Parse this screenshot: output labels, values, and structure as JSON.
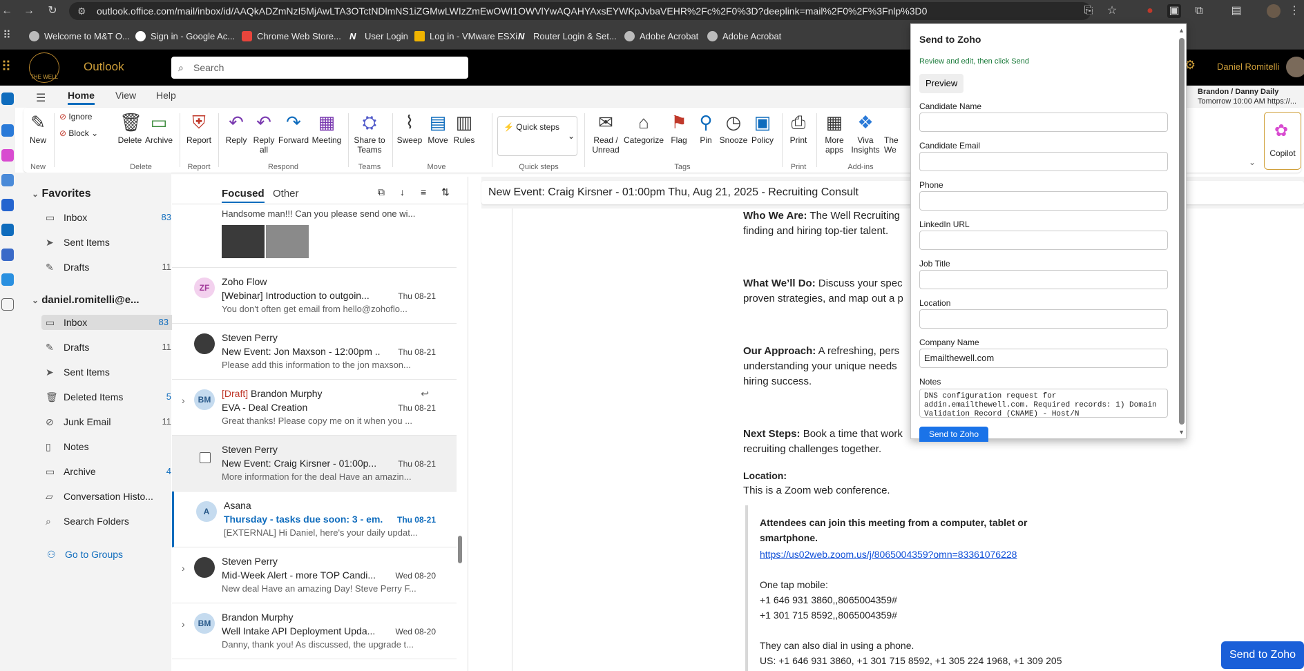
{
  "browser": {
    "url": "outlook.office.com/mail/inbox/id/AAQkADZmNzI5MjAwLTA3OTctNDlmNS1iZGMwLWIzZmEwOWI1OWVlYwAQAHYAxsEYWKpJvbaVEHR%2Fc%2F0%3D?deeplink=mail%2F0%2F%3Fnlp%3D0",
    "bookmarks": [
      "Welcome to M&T O...",
      "Sign in - Google Ac...",
      "Chrome Web Store...",
      "User Login",
      "Log in - VMware ESXi",
      "Router Login & Set...",
      "Adobe Acrobat",
      "Adobe Acrobat"
    ]
  },
  "header": {
    "app_name": "Outlook",
    "logo_text": "THE WELL",
    "search_placeholder": "Search",
    "user_name": "Daniel Romitelli",
    "next_event_title": "Brandon / Danny Daily",
    "next_event_time": "Tomorrow 10:00 AM https://..."
  },
  "ribbon": {
    "tabs": [
      "Home",
      "View",
      "Help"
    ],
    "buttons": {
      "new": "New",
      "ignore": "Ignore",
      "block": "Block",
      "delete": "Delete",
      "archive": "Archive",
      "report": "Report",
      "reply": "Reply",
      "reply_all": "Reply all",
      "forward": "Forward",
      "meeting": "Meeting",
      "share_teams": "Share to Teams",
      "sweep": "Sweep",
      "move": "Move",
      "rules": "Rules",
      "quick_steps": "Quick steps",
      "read_unread": "Read / Unread",
      "categorize": "Categorize",
      "flag": "Flag",
      "pin": "Pin",
      "snooze": "Snooze",
      "policy": "Policy",
      "print": "Print",
      "more_apps": "More apps",
      "viva": "Viva Insights",
      "the_well": "The We",
      "copilot": "Copilot"
    },
    "groups": {
      "new": "New",
      "delete": "Delete",
      "report": "Report",
      "respond": "Respond",
      "teams": "Teams",
      "move": "Move",
      "quick_steps": "Quick steps",
      "tags": "Tags",
      "print": "Print",
      "addins": "Add-ins"
    }
  },
  "folders": {
    "favorites_label": "Favorites",
    "favorites": [
      {
        "label": "Inbox",
        "count": "83"
      },
      {
        "label": "Sent Items",
        "count": ""
      },
      {
        "label": "Drafts",
        "count": "11"
      }
    ],
    "account_label": "daniel.romitelli@e...",
    "account": [
      {
        "label": "Inbox",
        "count": "83"
      },
      {
        "label": "Drafts",
        "count": "11"
      },
      {
        "label": "Sent Items",
        "count": ""
      },
      {
        "label": "Deleted Items",
        "count": "5"
      },
      {
        "label": "Junk Email",
        "count": "11"
      },
      {
        "label": "Notes",
        "count": ""
      },
      {
        "label": "Archive",
        "count": "4"
      },
      {
        "label": "Conversation Histo...",
        "count": ""
      },
      {
        "label": "Search Folders",
        "count": ""
      }
    ],
    "groups_link": "Go to Groups"
  },
  "messages": {
    "focused_tab": "Focused",
    "other_tab": "Other",
    "top_preview": "Handsome man!!! Can you please send one wi...",
    "items": [
      {
        "initials": "ZF",
        "from": "Zoho Flow",
        "draft": "",
        "subject": "[Webinar] Introduction to outgoin...",
        "date": "Thu 08-21",
        "preview": "You don't often get email from hello@zohoflo..."
      },
      {
        "initials": "",
        "from": "Steven Perry",
        "draft": "",
        "subject": "New Event: Jon Maxson - 12:00pm ...",
        "date": "Thu 08-21",
        "preview": "Please add this information to the jon maxson..."
      },
      {
        "initials": "BM",
        "from": "Brandon Murphy",
        "draft": "[Draft]",
        "subject": "EVA - Deal Creation",
        "date": "Thu 08-21",
        "preview": "Great thanks! Please copy me on it when you ..."
      },
      {
        "initials": "",
        "from": "Steven Perry",
        "draft": "",
        "subject": "New Event: Craig Kirsner - 01:00p...",
        "date": "Thu 08-21",
        "preview": "More information for the deal Have an amazin..."
      },
      {
        "initials": "A",
        "from": "Asana",
        "draft": "",
        "subject": "Thursday - tasks due soon: 3 - em...",
        "date": "Thu 08-21",
        "preview": "[EXTERNAL] Hi Daniel, here's your daily updat..."
      },
      {
        "initials": "",
        "from": "Steven Perry",
        "draft": "",
        "subject": "Mid-Week Alert - more TOP Candi...",
        "date": "Wed 08-20",
        "preview": "New deal Have an amazing Day! Steve Perry F..."
      },
      {
        "initials": "BM",
        "from": "Brandon Murphy",
        "draft": "",
        "subject": "Well Intake API Deployment Upda...",
        "date": "Wed 08-20",
        "preview": "Danny, thank you! As discussed, the upgrade t..."
      }
    ]
  },
  "reading": {
    "title": "New Event: Craig Kirsner - 01:00pm Thu, Aug 21, 2025 - Recruiting Consult",
    "who_label": "Who We Are:",
    "who_text": "The Well Recruiting",
    "who_text2": "finding and hiring top-tier talent.",
    "what_label": "What We’ll Do:",
    "what_text": "Discuss your spec",
    "what_text2": "proven strategies, and map out a p",
    "approach_label": "Our Approach:",
    "approach_text": "A refreshing, pers",
    "approach_text2": "understanding your unique needs",
    "approach_text3": "hiring success.",
    "next_label": "Next Steps:",
    "next_text": "Book a time that work",
    "next_text2": "recruiting challenges together.",
    "location_label": "Location:",
    "location_text": "This is a Zoom web conference.",
    "attendees": "Attendees can join this meeting from a computer, tablet or smartphone.",
    "zoom_link": "https://us02web.zoom.us/j/8065004359?omn=83361076228",
    "one_tap": "One tap mobile:",
    "phone1": "+1 646 931 3860,,8065004359#",
    "phone2": "+1 301 715 8592,,8065004359#",
    "dial": "They can also dial in using a phone.",
    "us": "US: +1 646 931 3860, +1 301 715 8592, +1 305 224 1968, +1 309 205"
  },
  "popup": {
    "title": "Send to Zoho",
    "subtitle": "Review and edit, then click Send",
    "preview_button": "Preview",
    "fields": {
      "candidate_name": {
        "label": "Candidate Name",
        "value": ""
      },
      "candidate_email": {
        "label": "Candidate Email",
        "value": ""
      },
      "phone": {
        "label": "Phone",
        "value": ""
      },
      "linkedin": {
        "label": "LinkedIn URL",
        "value": ""
      },
      "job_title": {
        "label": "Job Title",
        "value": ""
      },
      "location": {
        "label": "Location",
        "value": ""
      },
      "company": {
        "label": "Company Name",
        "value": "Emailthewell.com"
      }
    },
    "notes_label": "Notes",
    "notes_value": "DNS configuration request for addin.emailthewell.com. Required records: 1) Domain Validation Record (CNAME) - Host/N",
    "send_button": "Send to Zoho"
  },
  "floating_send": "Send to Zoho"
}
